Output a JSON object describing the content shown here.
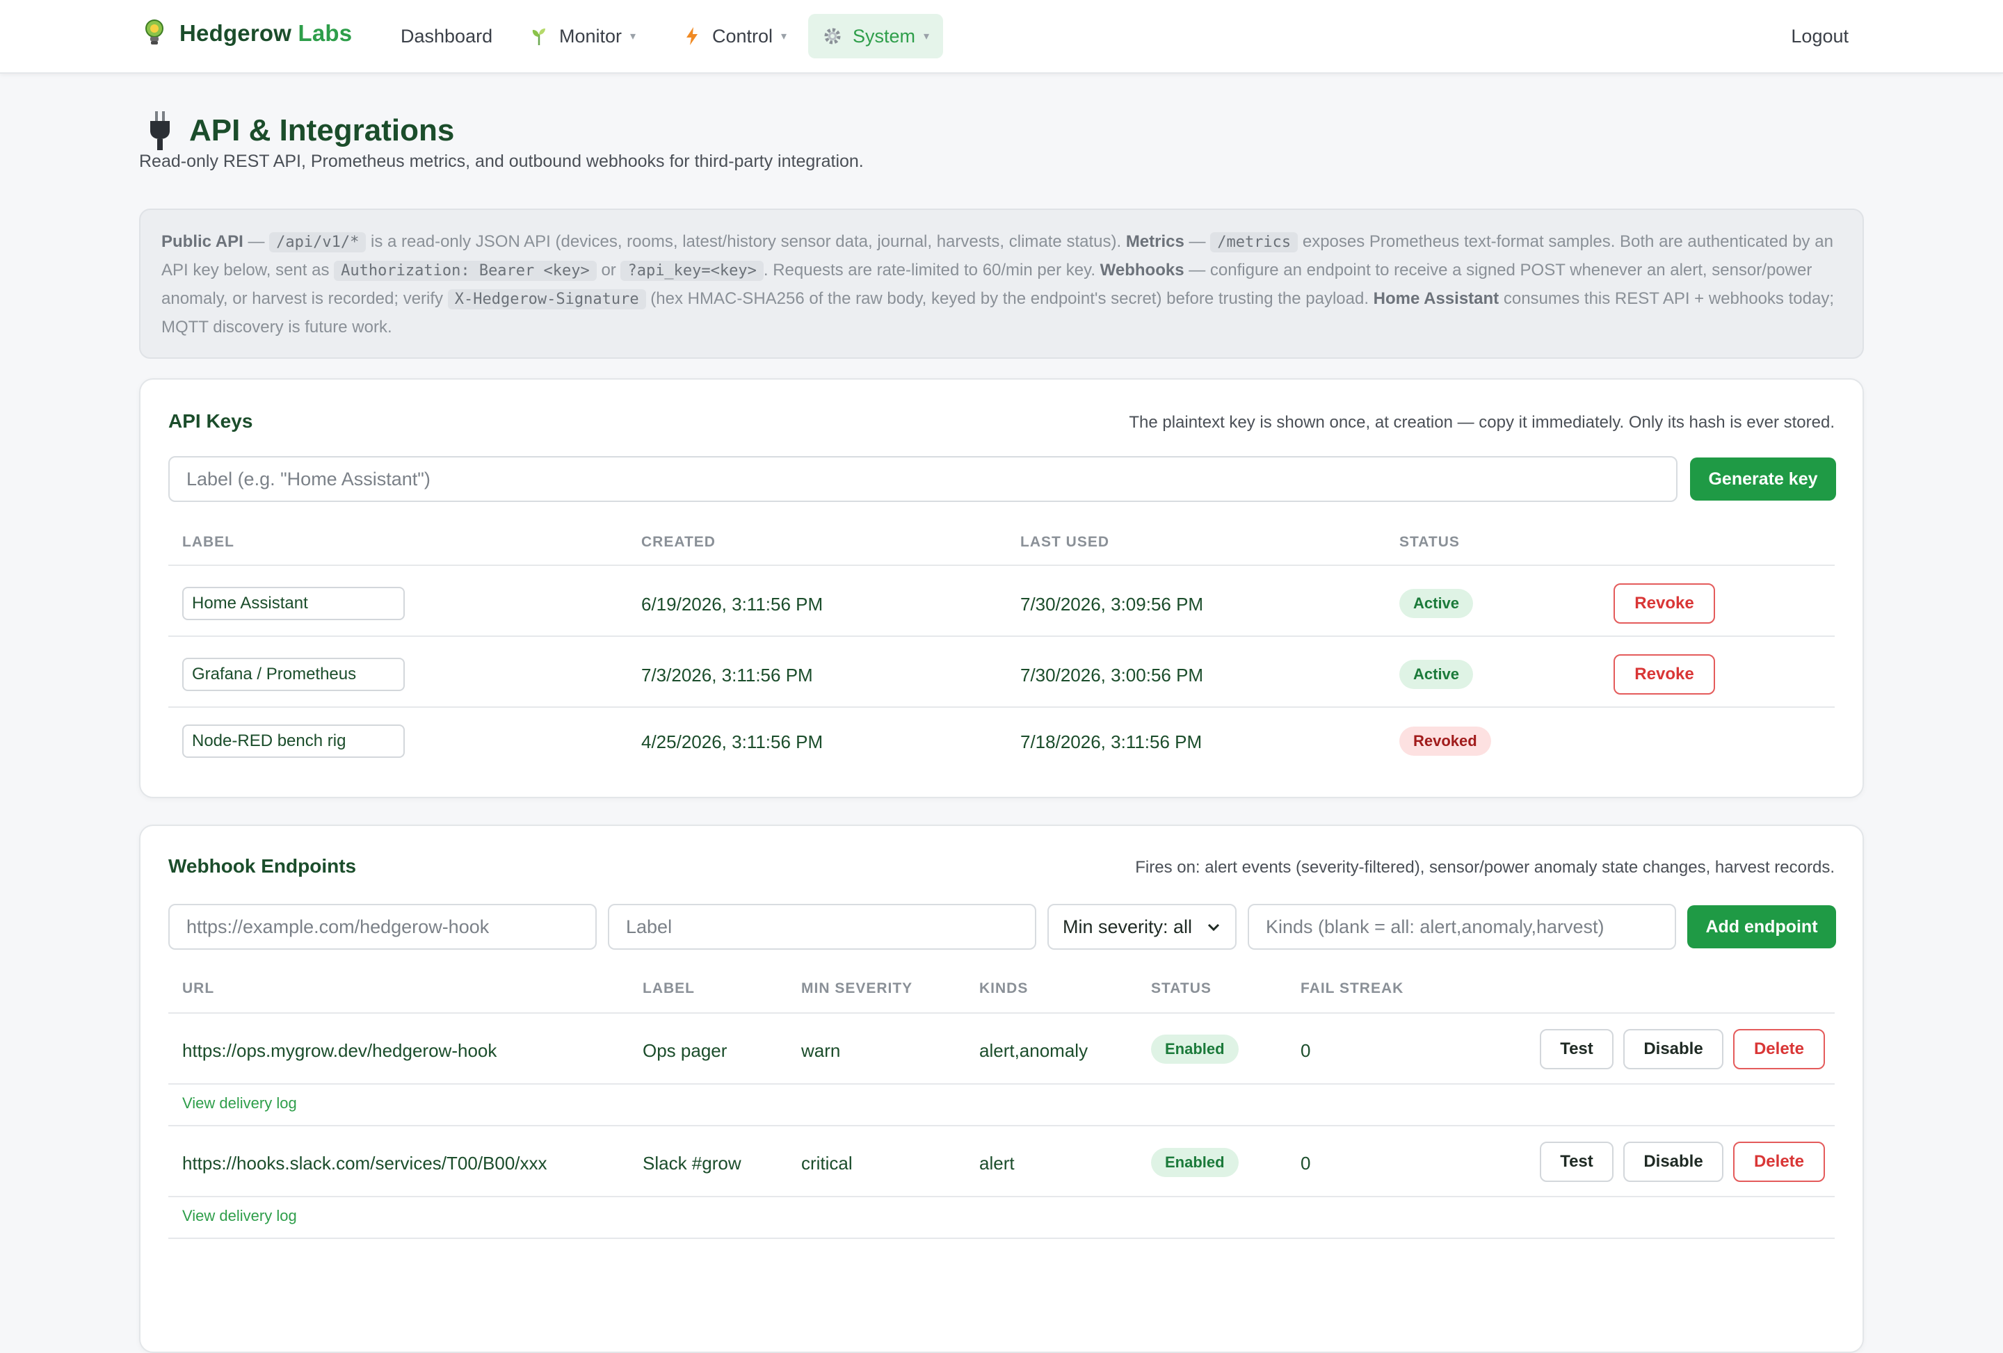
{
  "nav": {
    "brand_main": "Hedgerow",
    "brand_accent": "Labs",
    "items": [
      {
        "label": "Dashboard"
      },
      {
        "label": "Monitor",
        "icon": "sprout-icon"
      },
      {
        "label": "Control",
        "icon": "lightning-icon"
      },
      {
        "label": "System",
        "icon": "gear-icon"
      }
    ],
    "caret": "▾",
    "logout": "Logout"
  },
  "page": {
    "title": "API & Integrations",
    "subtitle": "Read-only REST API, Prometheus metrics, and outbound webhooks for third-party integration."
  },
  "info": {
    "public_api": "Public API",
    "dash": "—",
    "api_path": "/api/v1/*",
    "t1": "is a read-only JSON API (devices, rooms, latest/history sensor data, journal, harvests, climate status).",
    "metrics": "Metrics",
    "metrics_path": "/metrics",
    "t2": "exposes Prometheus text-format samples. Both are authenticated by an API key below, sent as",
    "auth_header": "Authorization: Bearer <key>",
    "or": "or",
    "query_param": "?api_key=<key>",
    "t3": ". Requests are rate-limited to 60/min per key.",
    "webhooks": "Webhooks",
    "t4": "— configure an endpoint to receive a signed POST whenever an alert, sensor/power anomaly, or harvest is recorded; verify",
    "sig_header": "X-Hedgerow-Signature",
    "t5": "(hex HMAC-SHA256 of the raw body, keyed by the endpoint's secret) before trusting the payload.",
    "home_assistant": "Home Assistant",
    "t6": "consumes this REST API + webhooks today; MQTT discovery is future work."
  },
  "api_keys": {
    "title": "API Keys",
    "note": "The plaintext key is shown once, at creation — copy it immediately. Only its hash is ever stored.",
    "placeholder": "Label (e.g. \"Home Assistant\")",
    "generate": "Generate key",
    "headers": [
      "LABEL",
      "CREATED",
      "LAST USED",
      "STATUS"
    ],
    "rows": [
      {
        "label": "Home Assistant",
        "created": "6/19/2026, 3:11:56 PM",
        "last_used": "7/30/2026, 3:09:56 PM",
        "status": "Active",
        "action": "Revoke"
      },
      {
        "label": "Grafana / Prometheus",
        "created": "7/3/2026, 3:11:56 PM",
        "last_used": "7/30/2026, 3:00:56 PM",
        "status": "Active",
        "action": "Revoke"
      },
      {
        "label": "Node-RED bench rig",
        "created": "4/25/2026, 3:11:56 PM",
        "last_used": "7/18/2026, 3:11:56 PM",
        "status": "Revoked",
        "action": ""
      }
    ]
  },
  "webhooks": {
    "title": "Webhook Endpoints",
    "note": "Fires on: alert events (severity-filtered), sensor/power anomaly state changes, harvest records.",
    "url_placeholder": "https://example.com/hedgerow-hook",
    "label_placeholder": "Label",
    "severity_select": "Min severity: all",
    "kinds_placeholder": "Kinds (blank = all: alert,anomaly,harvest)",
    "add": "Add endpoint",
    "headers": [
      "URL",
      "LABEL",
      "MIN SEVERITY",
      "KINDS",
      "STATUS",
      "FAIL STREAK"
    ],
    "rows": [
      {
        "url": "https://ops.mygrow.dev/hedgerow-hook",
        "label": "Ops pager",
        "severity": "warn",
        "kinds": "alert,anomaly",
        "status": "Enabled",
        "fail_streak": "0",
        "test": "Test",
        "disable": "Disable",
        "delete": "Delete",
        "log": "View delivery log"
      },
      {
        "url": "https://hooks.slack.com/services/T00/B00/xxx",
        "label": "Slack #grow",
        "severity": "critical",
        "kinds": "alert",
        "status": "Enabled",
        "fail_streak": "0",
        "test": "Test",
        "disable": "Disable",
        "delete": "Delete",
        "log": "View delivery log"
      }
    ]
  },
  "colors": {
    "brand_green": "#1b4d2b",
    "accent_green": "#2e9e4a",
    "primary_button": "#1f9a45",
    "danger": "#d93636"
  }
}
